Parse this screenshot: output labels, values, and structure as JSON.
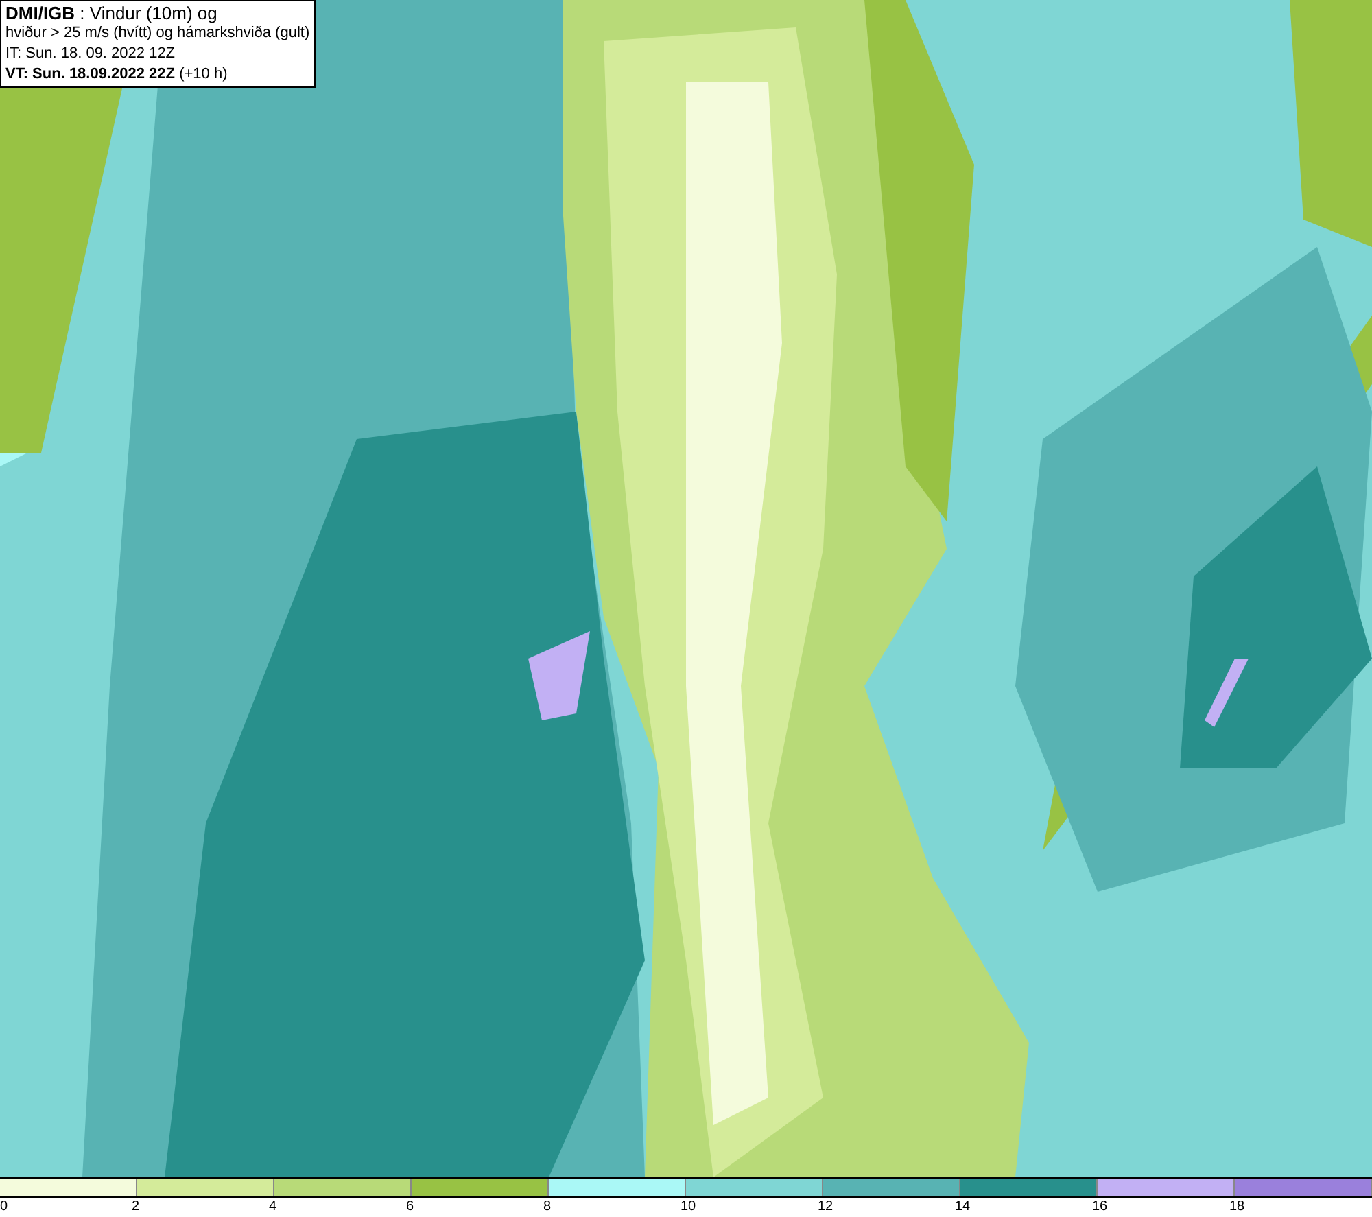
{
  "info_box": {
    "lines": [
      "**DMI/IGB** : Vindur (10m) og",
      "hviður > 25 m/s (hvítt) og hámarkshviða (gult)",
      "IT: Sun. 18. 09. 2022 12Z",
      "**VT: Sun. 18.09.2022 22Z** (+10 h)"
    ]
  },
  "legend": {
    "segments": [
      {
        "color": "#f4fbdc",
        "label": "0"
      },
      {
        "color": "#d4eb9a",
        "label": "2"
      },
      {
        "color": "#b8da78",
        "label": "4"
      },
      {
        "color": "#98c244",
        "label": "6"
      },
      {
        "color": "#aaf8f6",
        "label": "8"
      },
      {
        "color": "#7fd6d4",
        "label": "10"
      },
      {
        "color": "#58b3b3",
        "label": "12"
      },
      {
        "color": "#28908c",
        "label": "14"
      },
      {
        "color": "#c2b0f4",
        "label": "16"
      },
      {
        "color": "#9a80dc",
        "label": "18"
      }
    ]
  }
}
